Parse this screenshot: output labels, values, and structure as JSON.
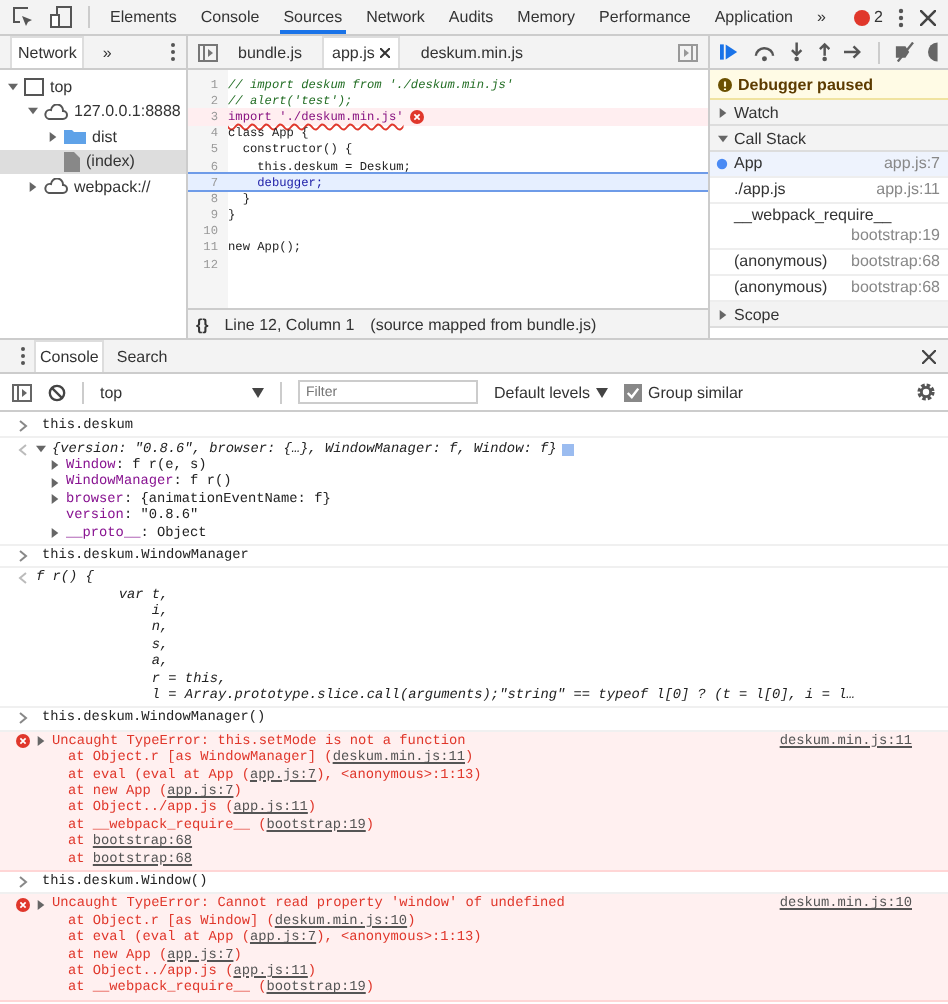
{
  "devtools_tabs": [
    {
      "label": "Elements",
      "selected": false
    },
    {
      "label": "Console",
      "selected": false
    },
    {
      "label": "Sources",
      "selected": true
    },
    {
      "label": "Network",
      "selected": false
    },
    {
      "label": "Audits",
      "selected": false
    },
    {
      "label": "Memory",
      "selected": false
    },
    {
      "label": "Performance",
      "selected": false
    },
    {
      "label": "Application",
      "selected": false
    }
  ],
  "more_tabs": "»",
  "error_count": "2",
  "navigator": {
    "tabs": [
      {
        "label": "Network",
        "selected": true
      }
    ],
    "more_tabs": "»",
    "tree": [
      {
        "label": "top",
        "kind": "frame",
        "expanded": true,
        "selected": false,
        "children": [
          {
            "label": "127.0.0.1:8888",
            "kind": "domain",
            "expanded": true,
            "selected": false,
            "children": [
              {
                "label": "dist",
                "kind": "folder",
                "expanded": false,
                "selected": false
              },
              {
                "label": "(index)",
                "kind": "file",
                "selected": true
              }
            ]
          },
          {
            "label": "webpack://",
            "kind": "domain",
            "expanded": false,
            "selected": false
          }
        ]
      }
    ]
  },
  "editor": {
    "tabs": [
      {
        "label": "bundle.js",
        "selected": false,
        "closable": false
      },
      {
        "label": "app.js",
        "selected": true,
        "closable": true
      },
      {
        "label": "deskum.min.js",
        "selected": false,
        "closable": false
      }
    ],
    "lines": [
      {
        "number": "1",
        "code": "// import deskum from './deskum.min.js'",
        "kind": "comment"
      },
      {
        "number": "2",
        "code": "// alert('test');",
        "kind": "comment"
      },
      {
        "number": "3",
        "code": "import './deskum.min.js'",
        "kind": "error"
      },
      {
        "number": "4",
        "code": "class App {",
        "kind": "code"
      },
      {
        "number": "5",
        "code": "  constructor() {",
        "kind": "code"
      },
      {
        "number": "6",
        "code": "    this.deskum = Deskum;",
        "kind": "code"
      },
      {
        "number": "7",
        "code": "    debugger;",
        "kind": "paused"
      },
      {
        "number": "8",
        "code": "  }",
        "kind": "code"
      },
      {
        "number": "9",
        "code": "}",
        "kind": "code"
      },
      {
        "number": "10",
        "kind": "code"
      },
      {
        "number": "11",
        "code": "new App();",
        "kind": "code"
      },
      {
        "number": "12",
        "kind": "code"
      }
    ],
    "format_button": "{}",
    "position": "Line 12, Column 1",
    "source_map": "(source mapped from bundle.js)"
  },
  "debugger": {
    "paused_message": "Debugger paused",
    "sections": [
      {
        "title": "Watch",
        "expanded": false
      },
      {
        "title": "Call Stack",
        "expanded": true,
        "frames": [
          {
            "name": "App",
            "location": "app.js:7",
            "selected": true
          },
          {
            "name": "./app.js",
            "location": "app.js:11",
            "selected": false
          },
          {
            "name": "__webpack_require__",
            "location": "bootstrap:19",
            "selected": false
          },
          {
            "name": "(anonymous)",
            "location": "bootstrap:68",
            "selected": false
          },
          {
            "name": "(anonymous)",
            "location": "bootstrap:68",
            "selected": false
          }
        ]
      },
      {
        "title": "Scope",
        "expanded": false
      }
    ]
  },
  "drawer": {
    "tabs": [
      {
        "label": "Console",
        "selected": true
      },
      {
        "label": "Search",
        "selected": false
      }
    ],
    "context": "top",
    "filter": {
      "placeholder": "Filter"
    },
    "levels": "Default levels",
    "group_similar": {
      "label": "Group similar",
      "checked": true
    }
  },
  "console": [
    {
      "kind": "input",
      "text": "this.deskum"
    },
    {
      "kind": "object",
      "expanded": true,
      "summary": "{version: \"0.8.6\", browser: {…}, WindowManager: f, Window: f}",
      "properties": [
        {
          "key": "Window",
          "separator": ":",
          "value": "f r(e, s)",
          "expandable": true
        },
        {
          "key": "WindowManager",
          "separator": ":",
          "value": "f r()",
          "expandable": true
        },
        {
          "key": "browser",
          "separator": ":",
          "value": "{animationEventName: f}",
          "expandable": true
        },
        {
          "key": "version",
          "separator": ":",
          "value": "\"0.8.6\"",
          "expandable": false
        },
        {
          "key": "__proto__",
          "separator": ":",
          "value": "Object",
          "expandable": true
        }
      ]
    },
    {
      "kind": "input",
      "text": "this.deskum.WindowManager"
    },
    {
      "kind": "function",
      "lines": [
        "f r() {",
        "          var t,",
        "              i,",
        "              n,",
        "              s,",
        "              a,",
        "              r = this,",
        "              l = Array.prototype.slice.call(arguments);\"string\" == typeof l[0] ? (t = l[0], i = l…"
      ]
    },
    {
      "kind": "input",
      "text": "this.deskum.WindowManager()"
    },
    {
      "kind": "error",
      "message": "Uncaught TypeError: this.setMode is not a function",
      "source": "deskum.min.js:11",
      "stack": [
        {
          "prefix": "at Object.r [as WindowManager] (",
          "link": "deskum.min.js:11",
          "suffix": ")"
        },
        {
          "prefix": "at eval (eval at App (",
          "link": "app.js:7",
          "suffix": "), <anonymous>:1:13)"
        },
        {
          "prefix": "at new App (",
          "link": "app.js:7",
          "suffix": ")"
        },
        {
          "prefix": "at Object../app.js (",
          "link": "app.js:11",
          "suffix": ")"
        },
        {
          "prefix": "at __webpack_require__ (",
          "link": "bootstrap:19",
          "suffix": ")"
        },
        {
          "prefix": "at ",
          "link": "bootstrap:68"
        },
        {
          "prefix": "at ",
          "link": "bootstrap:68"
        }
      ]
    },
    {
      "kind": "input",
      "text": "this.deskum.Window()"
    },
    {
      "kind": "error",
      "message": "Uncaught TypeError: Cannot read property 'window' of undefined",
      "source": "deskum.min.js:10",
      "stack": [
        {
          "prefix": "at Object.r [as Window] (",
          "link": "deskum.min.js:10",
          "suffix": ")"
        },
        {
          "prefix": "at eval (eval at App (",
          "link": "app.js:7",
          "suffix": "), <anonymous>:1:13)"
        },
        {
          "prefix": "at new App (",
          "link": "app.js:7",
          "suffix": ")"
        },
        {
          "prefix": "at Object../app.js (",
          "link": "app.js:11",
          "suffix": ")"
        },
        {
          "prefix": "at __webpack_require__ (",
          "link": "bootstrap:19",
          "suffix": ")"
        }
      ]
    }
  ]
}
